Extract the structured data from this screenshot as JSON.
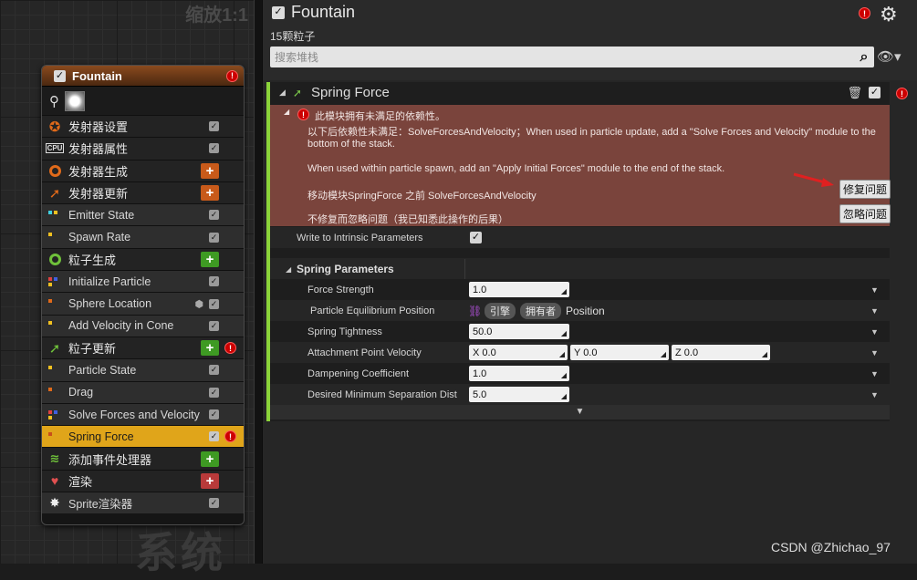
{
  "graph": {
    "zoom_label": "缩放1:1",
    "system_watermark": "系统",
    "node": {
      "title": "Fountain",
      "rows": [
        {
          "kind": "group",
          "label": "发射器设置",
          "icon": "gear-orange-icon"
        },
        {
          "kind": "group",
          "label": "发射器属性",
          "icon": "cpu-icon"
        },
        {
          "kind": "group",
          "label": "发射器生成",
          "icon": "ring-orange-icon",
          "plus": "orange"
        },
        {
          "kind": "group",
          "label": "发射器更新",
          "icon": "arrow-orange-icon",
          "plus": "orange"
        },
        {
          "kind": "mod",
          "label": "Emitter State",
          "dots": "cyan-yellow"
        },
        {
          "kind": "mod",
          "label": "Spawn Rate",
          "dots": "yellow"
        },
        {
          "kind": "group",
          "label": "粒子生成",
          "icon": "ring-green-icon",
          "plus": "green"
        },
        {
          "kind": "mod",
          "label": "Initialize Particle",
          "dots": "multi"
        },
        {
          "kind": "mod",
          "label": "Sphere Location",
          "dots": "orange",
          "cube": true
        },
        {
          "kind": "mod",
          "label": "Add Velocity in Cone",
          "dots": "yellow"
        },
        {
          "kind": "group",
          "label": "粒子更新",
          "icon": "arrow-green-icon",
          "plus": "green",
          "error": true
        },
        {
          "kind": "mod",
          "label": "Particle State",
          "dots": "yellow"
        },
        {
          "kind": "mod",
          "label": "Drag",
          "dots": "orange"
        },
        {
          "kind": "mod",
          "label": "Solve Forces and Velocity",
          "dots": "multi"
        },
        {
          "kind": "sel",
          "label": "Spring Force",
          "dots": "orange-sq",
          "error": true
        },
        {
          "kind": "group",
          "label": "添加事件处理器",
          "icon": "signal-green-icon",
          "plus": "green"
        },
        {
          "kind": "group",
          "label": "渲染",
          "icon": "heart-red-icon",
          "plus": "red"
        },
        {
          "kind": "mod",
          "label": "Sprite渲染器",
          "icon": "sprite-icon"
        }
      ]
    }
  },
  "details": {
    "title": "Fountain",
    "particle_count": "15颗粒子",
    "search_placeholder": "搜索堆栈",
    "module": {
      "title": "Spring Force",
      "warning_header": "此模块拥有未满足的依赖性。",
      "warning_line1": "以下后依赖性未满足：SolveForcesAndVelocity；When used in particle update, add a \"Solve Forces and Velocity\" module to the bottom of the stack.",
      "warning_line2": "When used within particle spawn, add an \"Apply Initial Forces\" module to the end of the stack.",
      "fix_text": "移动模块SpringForce 之前 SolveForcesAndVelocity",
      "fix_button": "修复问题",
      "ignore_text": "不修复而忽略问题（我已知悉此操作的后果）",
      "ignore_button": "忽略问题",
      "write_intrinsic": "Write to Intrinsic Parameters",
      "section": "Spring Parameters",
      "params": {
        "force_strength": {
          "label": "Force Strength",
          "value": "1.0"
        },
        "equilibrium": {
          "label": "Particle Equilibrium Position",
          "pill1": "引擎",
          "pill2": "拥有者",
          "value": "Position"
        },
        "tightness": {
          "label": "Spring Tightness",
          "value": "50.0"
        },
        "attach_velocity": {
          "label": "Attachment Point Velocity",
          "x": "X 0.0",
          "y": "Y 0.0",
          "z": "Z 0.0"
        },
        "dampening": {
          "label": "Dampening Coefficient",
          "value": "1.0"
        },
        "min_sep": {
          "label": "Desired Minimum Separation Dist",
          "value": "5.0"
        }
      }
    }
  },
  "watermark": "CSDN @Zhichao_97",
  "colors": {
    "accent_green": "#8bd33a",
    "warning_bg": "#7a443c",
    "selected_row": "#e0a51a"
  }
}
